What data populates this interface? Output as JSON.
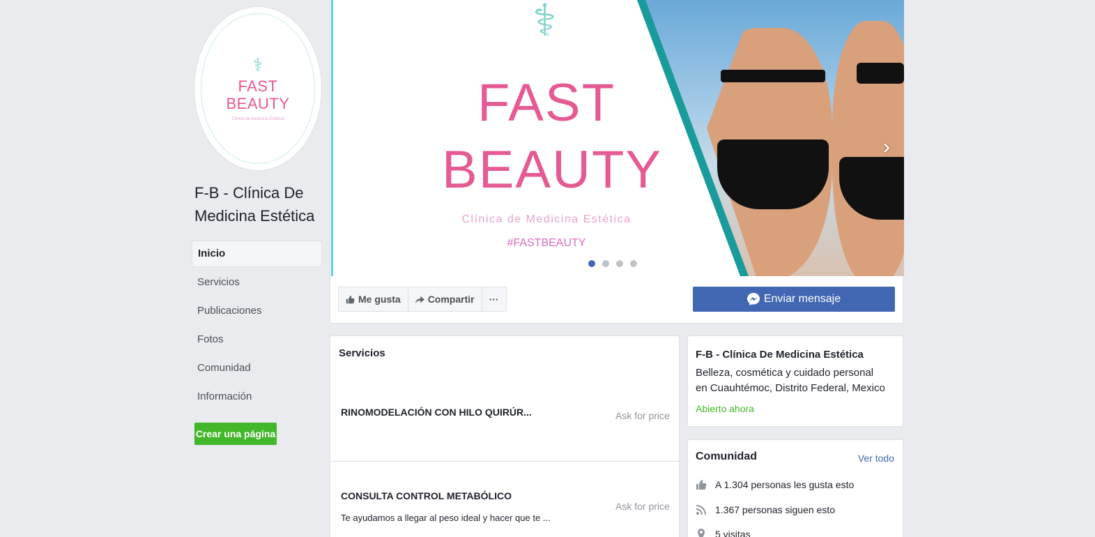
{
  "profile": {
    "logo_symbol": "⚕",
    "logo_line1": "FAST",
    "logo_line2": "BEAUTY",
    "logo_sub": "Clínica de Medicina Estética"
  },
  "page_title": "F-B - Clínica De Medicina Estética",
  "nav": {
    "items": [
      {
        "label": "Inicio",
        "active": true
      },
      {
        "label": "Servicios"
      },
      {
        "label": "Publicaciones"
      },
      {
        "label": "Fotos"
      },
      {
        "label": "Comunidad"
      },
      {
        "label": "Información"
      }
    ],
    "create_page": "Crear una página"
  },
  "cover": {
    "symbol": "⚕",
    "line1": "FAST",
    "line2": "BEAUTY",
    "subtitle": "Clínica de Medicina Estética",
    "hashtag": "#FASTBEAUTY",
    "slide_count": 4,
    "active_slide": 1,
    "next_arrow": "›"
  },
  "actions": {
    "like": "Me gusta",
    "share": "Compartir",
    "more": "···",
    "message": "Enviar mensaje"
  },
  "services": {
    "title": "Servicios",
    "items": [
      {
        "name": "RINOMODELACIÓN CON HILO QUIRÚR...",
        "price": "Ask for price",
        "desc": ""
      },
      {
        "name": "CONSULTA CONTROL METABÓLICO",
        "price": "Ask for price",
        "desc": "Te ayudamos a llegar al peso ideal y hacer que te ..."
      }
    ]
  },
  "about": {
    "name": "F-B - Clínica De Medicina Estética",
    "category": "Belleza, cosmética y cuidado personal",
    "location": "en Cuauhtémoc, Distrito Federal, Mexico",
    "status": "Abierto ahora"
  },
  "community": {
    "title": "Comunidad",
    "see_all": "Ver todo",
    "likes": "A 1.304 personas les gusta esto",
    "follows": "1.367 personas siguen esto",
    "visits": "5 visitas"
  },
  "colors": {
    "brand_blue": "#4267b2",
    "green": "#42b72a",
    "logo_pink": "#e65a93",
    "logo_teal": "#7fd3cb"
  }
}
